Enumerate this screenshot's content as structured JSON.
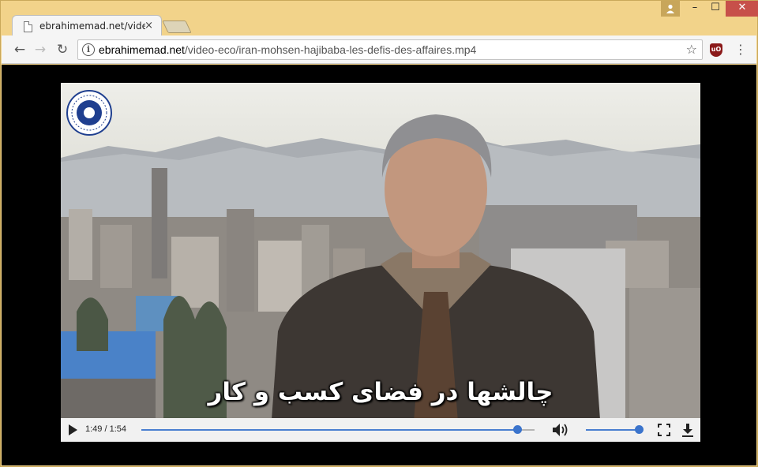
{
  "tab": {
    "title": "ebrahimemad.net/video-eco",
    "close": "×"
  },
  "window_controls": {
    "minimize": "–",
    "maximize": "☐",
    "close": "✕"
  },
  "nav": {
    "back": "←",
    "forward": "→",
    "reload": "↻",
    "info": "i",
    "star": "☆",
    "menu": "⋮",
    "extension": "uO"
  },
  "address": {
    "host": "ebrahimemad.net",
    "path": "/video-eco/iran-mohsen-hajibaba-les-defis-des-affaires.mp4"
  },
  "video": {
    "subtitle": "چالشها در فضای کسب و کار"
  },
  "player": {
    "time": "1:49 / 1:54",
    "progress": 0.956,
    "volume": 1.0
  },
  "icons": [
    "doc-icon",
    "user-icon",
    "info-icon",
    "star-icon",
    "ublock-icon",
    "menu-icon",
    "play-icon",
    "volume-icon",
    "fullscreen-icon",
    "download-icon"
  ],
  "colors": {
    "frame": "#f2d38a",
    "accent": "#3b74cc",
    "close": "#c7504a"
  }
}
